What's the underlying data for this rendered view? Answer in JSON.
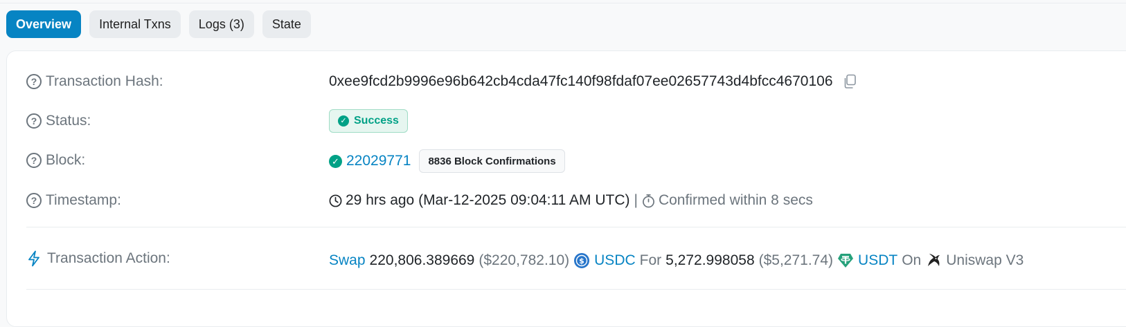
{
  "tabs": [
    {
      "label": "Overview",
      "active": true
    },
    {
      "label": "Internal Txns",
      "active": false
    },
    {
      "label": "Logs (3)",
      "active": false
    },
    {
      "label": "State",
      "active": false
    }
  ],
  "overview": {
    "tx_hash": {
      "label": "Transaction Hash:",
      "value": "0xee9fcd2b9996e96b642cb4cda47fc140f98fdaf07ee02657743d4bfcc4670106",
      "icon": "copy-icon"
    },
    "status": {
      "label": "Status:",
      "value": "Success",
      "color": "#00a186"
    },
    "block": {
      "label": "Block:",
      "number": "22029771",
      "confirmations": "8836 Block Confirmations"
    },
    "timestamp": {
      "label": "Timestamp:",
      "value": "29 hrs ago (Mar-12-2025 09:04:11 AM UTC)",
      "separator": "|",
      "confirmed": "Confirmed within 8 secs"
    },
    "action": {
      "label": "Transaction Action:",
      "verb": "Swap",
      "amount_in": "220,806.389669",
      "usd_in": "($220,782.10)",
      "token_in": "USDC",
      "for_word": "For",
      "amount_out": "5,272.998058",
      "usd_out": "($5,271.74)",
      "token_out": "USDT",
      "on_word": "On",
      "dex": "Uniswap V3"
    }
  },
  "colors": {
    "accent": "#0784c3",
    "success": "#00a186",
    "muted": "#6c757d"
  }
}
